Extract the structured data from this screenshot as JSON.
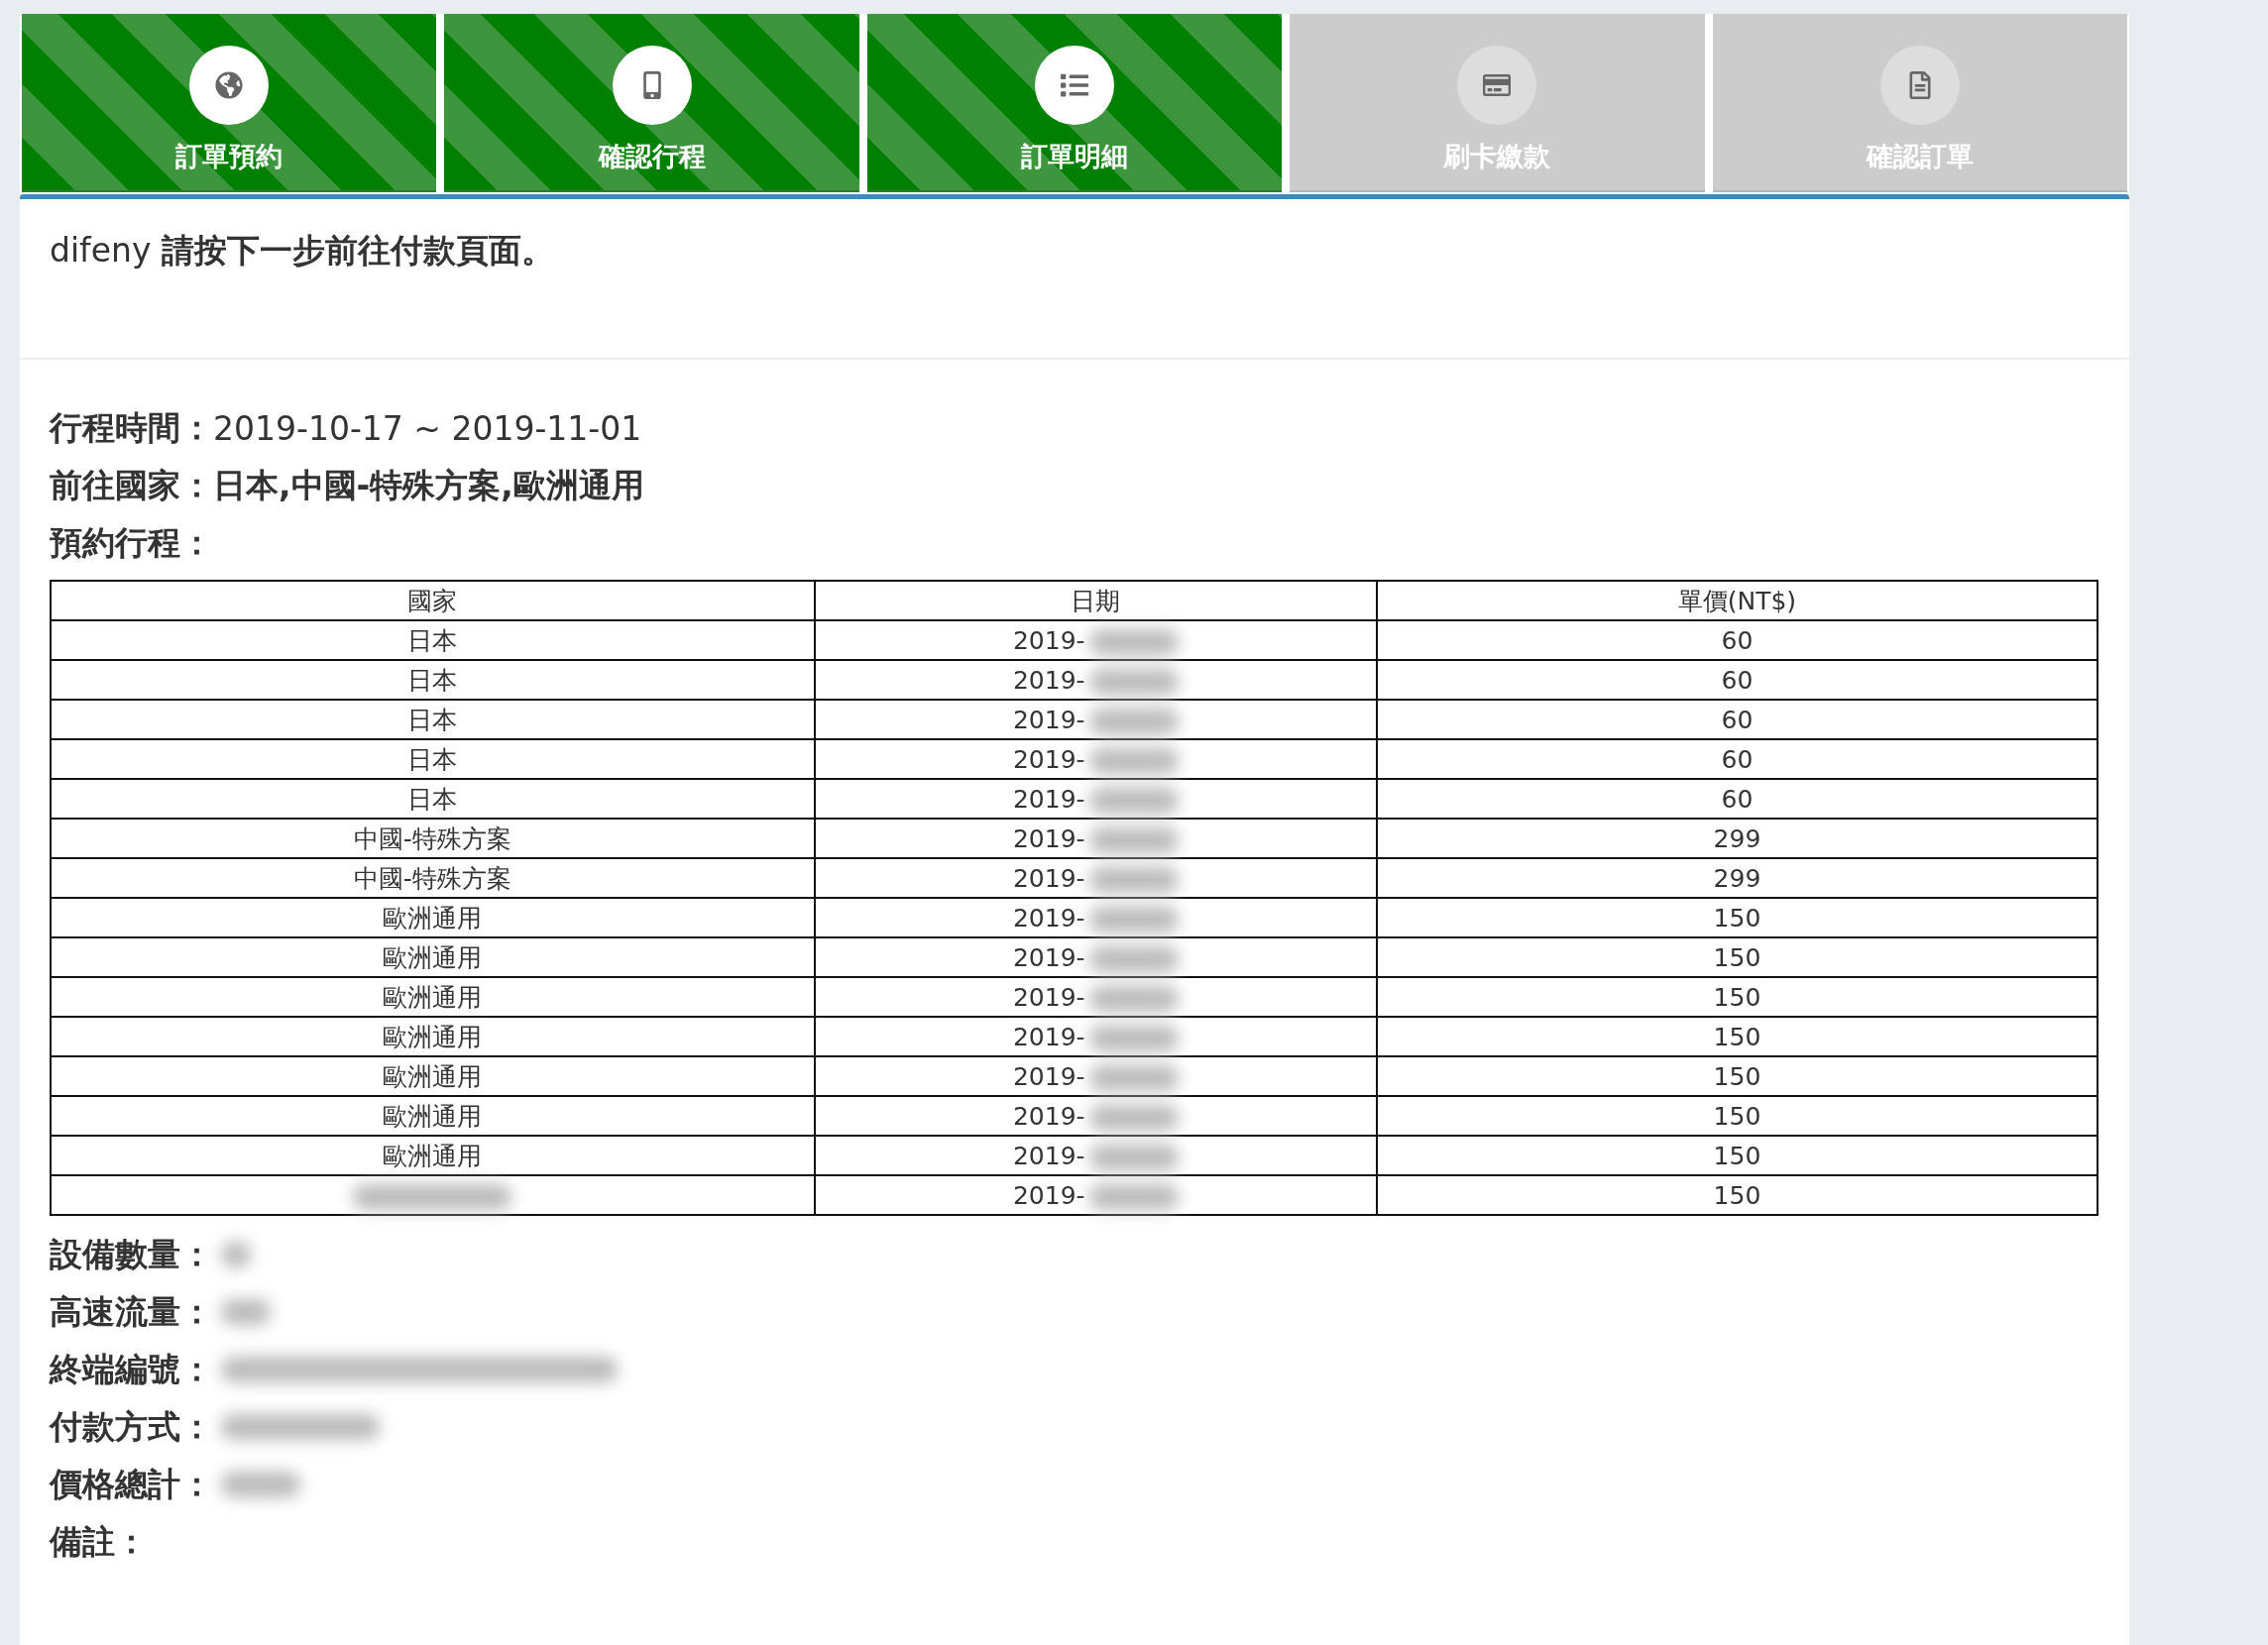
{
  "steps": [
    {
      "label": "訂單預約",
      "completed": true
    },
    {
      "label": "確認行程",
      "completed": true
    },
    {
      "label": "訂單明細",
      "completed": true
    },
    {
      "label": "刷卡繳款",
      "completed": false
    },
    {
      "label": "確認訂單",
      "completed": false
    }
  ],
  "message": "difeny **請按下一步前往付款頁面。**",
  "summary": [
    {
      "label": "行程時間：",
      "value": "2019-10-17 ~ 2019-11-01"
    },
    {
      "label": "前往國家：",
      "value": "日本,中國-特殊方案,歐洲通用"
    },
    {
      "label": "預約行程："
    }
  ],
  "table": {
    "columns": [
      "國家",
      "日期",
      "單價(NT$)"
    ],
    "rows": [
      {
        "cells": [
          {
            "text": "日本"
          },
          {
            "text": "2019-",
            "redacted": true
          },
          {
            "text": "60"
          }
        ]
      },
      {
        "cells": [
          {
            "text": "日本"
          },
          {
            "text": "2019-",
            "redacted": true
          },
          {
            "text": "60"
          }
        ]
      },
      {
        "cells": [
          {
            "text": "日本"
          },
          {
            "text": "2019-",
            "redacted": true
          },
          {
            "text": "60"
          }
        ]
      },
      {
        "cells": [
          {
            "text": "日本"
          },
          {
            "text": "2019-",
            "redacted": true
          },
          {
            "text": "60"
          }
        ]
      },
      {
        "cells": [
          {
            "text": "日本"
          },
          {
            "text": "2019-",
            "redacted": true
          },
          {
            "text": "60"
          }
        ]
      },
      {
        "cells": [
          {
            "text": "中國-特殊方案"
          },
          {
            "text": "2019-",
            "redacted": true
          },
          {
            "text": "299"
          }
        ]
      },
      {
        "cells": [
          {
            "text": "中國-特殊方案"
          },
          {
            "text": "2019-",
            "redacted": true
          },
          {
            "text": "299"
          }
        ]
      },
      {
        "cells": [
          {
            "text": "歐洲通用"
          },
          {
            "text": "2019-",
            "redacted": true
          },
          {
            "text": "150"
          }
        ]
      },
      {
        "cells": [
          {
            "text": "歐洲通用"
          },
          {
            "text": "2019-",
            "redacted": true
          },
          {
            "text": "150"
          }
        ]
      },
      {
        "cells": [
          {
            "text": "歐洲通用"
          },
          {
            "text": "2019-",
            "redacted": true
          },
          {
            "text": "150"
          }
        ]
      },
      {
        "cells": [
          {
            "text": "歐洲通用"
          },
          {
            "text": "2019-",
            "redacted": true
          },
          {
            "text": "150"
          }
        ]
      },
      {
        "cells": [
          {
            "text": "歐洲通用"
          },
          {
            "text": "2019-",
            "redacted": true
          },
          {
            "text": "150"
          }
        ]
      },
      {
        "cells": [
          {
            "text": "歐洲通用"
          },
          {
            "text": "2019-",
            "redacted": true
          },
          {
            "text": "150"
          }
        ]
      },
      {
        "cells": [
          {
            "text": "歐洲通用"
          },
          {
            "text": "2019-",
            "redacted": true
          },
          {
            "text": "150"
          }
        ]
      },
      {
        "cells": [
          {
            "redacted": true
          },
          {
            "text": "2019-",
            "redacted": true
          },
          {
            "text": "150"
          }
        ]
      }
    ]
  },
  "details": [
    {
      "label": "設備數量：",
      "redacted": true
    },
    {
      "label": "高速流量：",
      "redacted": true
    },
    {
      "label": "終端編號：",
      "redacted": true
    },
    {
      "label": "付款方式：",
      "redacted": true
    },
    {
      "label": "價格總計：",
      "redacted": true
    },
    {
      "label": "備註："
    }
  ]
}
